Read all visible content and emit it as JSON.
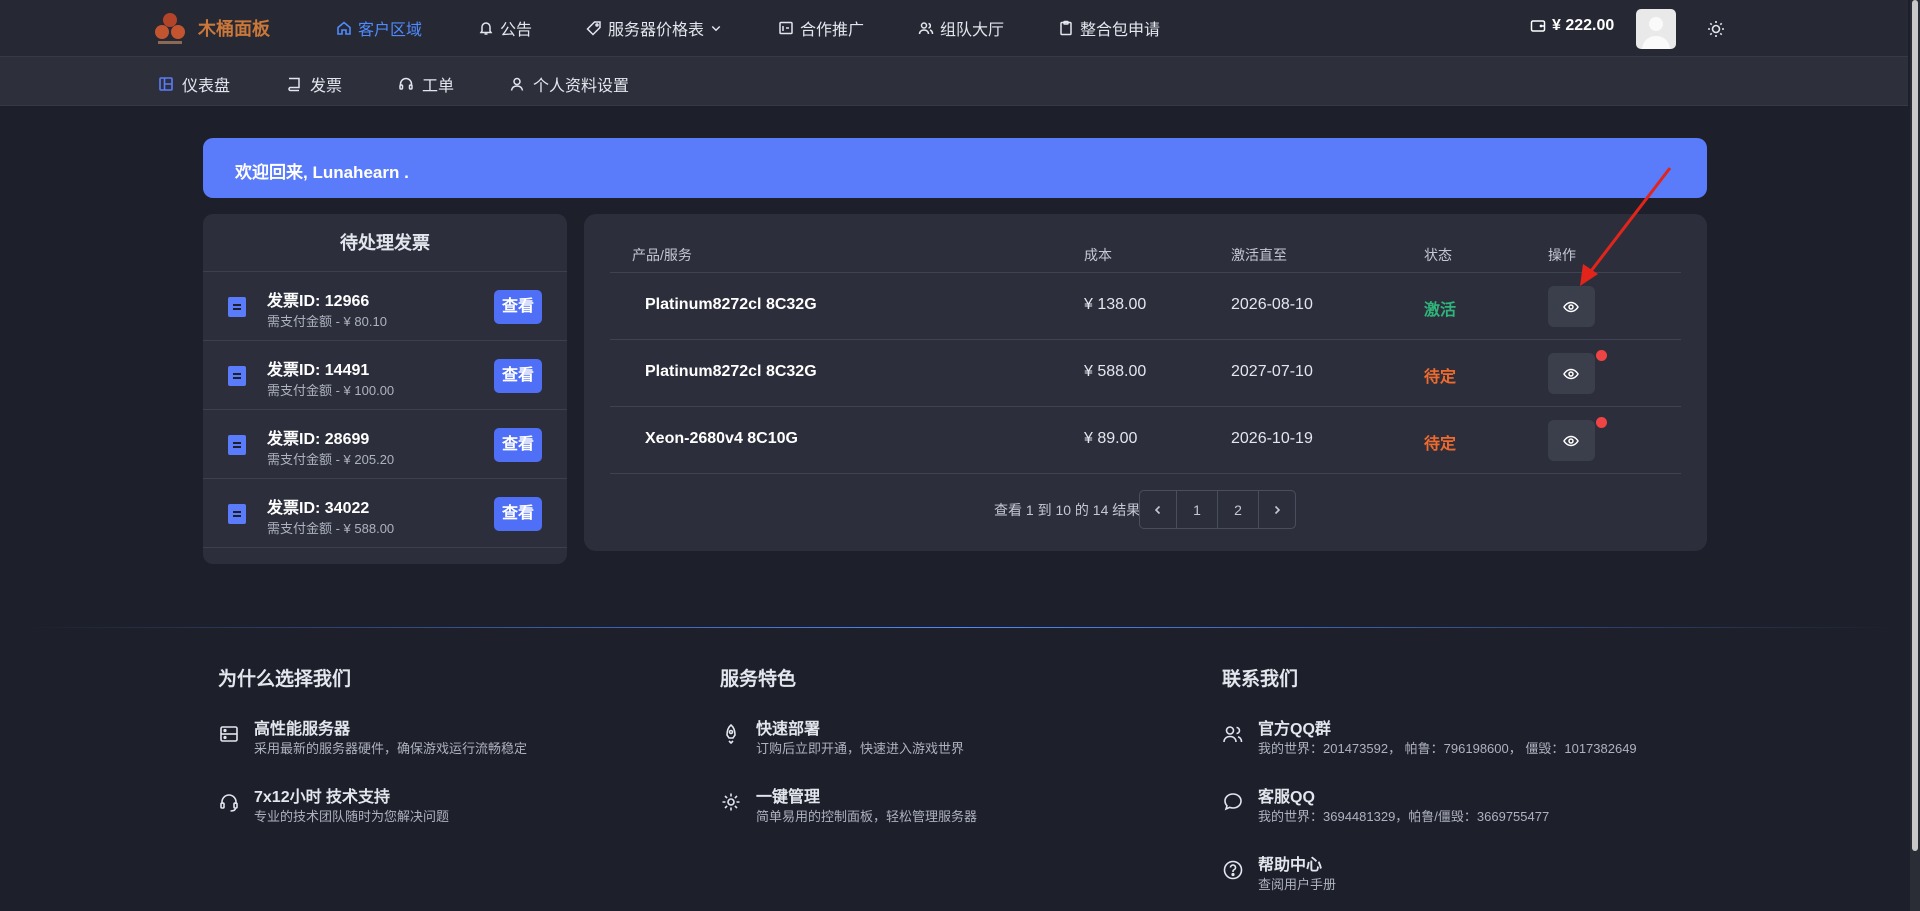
{
  "brand": {
    "name": "木桶面板"
  },
  "topnav": {
    "items": [
      {
        "label": "客户区域",
        "icon": "home-icon",
        "active": true
      },
      {
        "label": "公告",
        "icon": "bell-icon"
      },
      {
        "label": "服务器价格表",
        "icon": "tag-icon",
        "dropdown": true
      },
      {
        "label": "合作推广",
        "icon": "affiliate-icon"
      },
      {
        "label": "组队大厅",
        "icon": "users-icon"
      },
      {
        "label": "整合包申请",
        "icon": "clipboard-icon"
      }
    ],
    "balance": "¥ 222.00"
  },
  "subnav": {
    "items": [
      {
        "label": "仪表盘",
        "icon": "dashboard-icon"
      },
      {
        "label": "发票",
        "icon": "invoice-icon"
      },
      {
        "label": "工单",
        "icon": "headset-icon"
      },
      {
        "label": "个人资料设置",
        "icon": "user-icon"
      }
    ]
  },
  "welcome": "欢迎回来, Lunahearn .",
  "pending_invoices": {
    "title": "待处理发票",
    "button_label": "查看",
    "items": [
      {
        "title": "发票ID: 12966",
        "amount": "需支付金额 - ¥ 80.10"
      },
      {
        "title": "发票ID: 14491",
        "amount": "需支付金额 - ¥ 100.00"
      },
      {
        "title": "发票ID: 28699",
        "amount": "需支付金额 - ¥ 205.20"
      },
      {
        "title": "发票ID: 34022",
        "amount": "需支付金额 - ¥ 588.00"
      }
    ]
  },
  "services": {
    "columns": [
      "产品/服务",
      "成本",
      "激活直至",
      "状态",
      "操作"
    ],
    "rows": [
      {
        "name": "Platinum8272cl 8C32G",
        "cost": "¥ 138.00",
        "until": "2026-08-10",
        "status": "激活",
        "status_kind": "active"
      },
      {
        "name": "Platinum8272cl 8C32G",
        "cost": "¥ 588.00",
        "until": "2027-07-10",
        "status": "待定",
        "status_kind": "pending"
      },
      {
        "name": "Xeon-2680v4 8C10G",
        "cost": "¥ 89.00",
        "until": "2026-10-19",
        "status": "待定",
        "status_kind": "pending"
      }
    ],
    "pagination": {
      "summary": "查看 1 到 10 的 14 结果",
      "pages": [
        "1",
        "2"
      ]
    }
  },
  "footer": {
    "columns": [
      {
        "heading": "为什么选择我们",
        "items": [
          {
            "icon": "server-icon",
            "title": "高性能服务器",
            "desc": "采用最新的服务器硬件，确保游戏运行流畅稳定"
          },
          {
            "icon": "headset-icon",
            "title": "7x12小时 技术支持",
            "desc": "专业的技术团队随时为您解决问题"
          }
        ]
      },
      {
        "heading": "服务特色",
        "items": [
          {
            "icon": "rocket-icon",
            "title": "快速部署",
            "desc": "订购后立即开通，快速进入游戏世界"
          },
          {
            "icon": "gear-icon",
            "title": "一键管理",
            "desc": "简单易用的控制面板，轻松管理服务器"
          }
        ]
      },
      {
        "heading": "联系我们",
        "items": [
          {
            "icon": "users-icon",
            "title": "官方QQ群",
            "desc": "我的世界：201473592， 帕鲁：796198600， 僵毁：1017382649"
          },
          {
            "icon": "chat-icon",
            "title": "客服QQ",
            "desc": "我的世界：3694481329，帕鲁/僵毁：3669755477"
          },
          {
            "icon": "help-icon",
            "title": "帮助中心",
            "desc": "查阅用户手册"
          }
        ]
      }
    ]
  },
  "colors": {
    "accent": "#5b7cfa",
    "active": "#2fb47a",
    "pending": "#f06a2e",
    "alert_dot": "#ef4444",
    "annotation_arrow": "#e3241b"
  }
}
